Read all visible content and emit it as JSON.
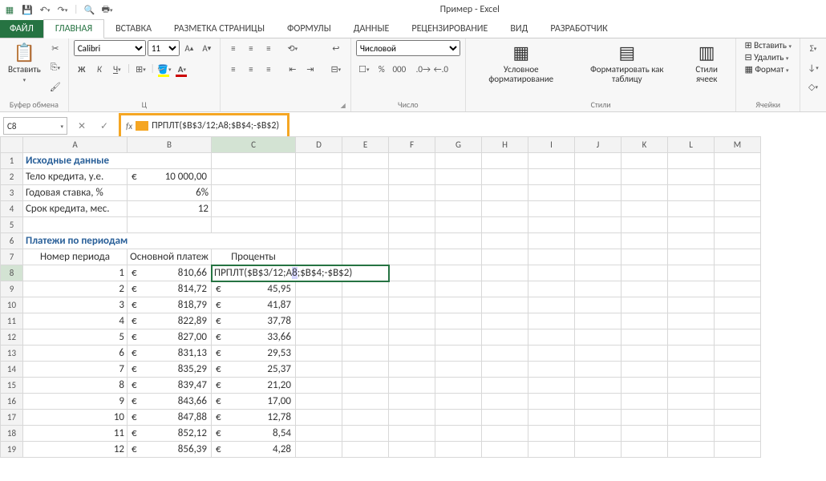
{
  "title": "Пример - Excel",
  "tabs": {
    "file": "ФАЙЛ",
    "list": [
      "ГЛАВНАЯ",
      "ВСТАВКА",
      "РАЗМЕТКА СТРАНИЦЫ",
      "ФОРМУЛЫ",
      "ДАННЫЕ",
      "РЕЦЕНЗИРОВАНИЕ",
      "ВИД",
      "РАЗРАБОТЧИК"
    ]
  },
  "ribbon": {
    "paste": "Вставить",
    "clipboard_label": "Буфер обмена",
    "font_name": "Calibri",
    "font_size": "11",
    "font_label": "Ц",
    "number_format": "Числовой",
    "number_label": "Число",
    "cond_fmt": "Условное форматирование",
    "fmt_table": "Форматировать как таблицу",
    "cell_styles": "Стили ячеек",
    "styles_label": "Стили",
    "insert": "Вставить",
    "delete": "Удалить",
    "format": "Формат",
    "cells_label": "Ячейки"
  },
  "formula_bar": {
    "name_box": "C8",
    "formula": "ПРПЛТ($B$3/12;A8;$B$4;-$B$2)"
  },
  "columns": [
    "A",
    "B",
    "C",
    "D",
    "E",
    "F",
    "G",
    "H",
    "I",
    "J",
    "K",
    "L",
    "M"
  ],
  "sheet": {
    "r1": {
      "A": "Исходные данные"
    },
    "r2": {
      "A": "Тело кредита, у.е.",
      "B_sym": "€",
      "B_val": "10 000,00"
    },
    "r3": {
      "A": "Годовая ставка, %",
      "B": "6%"
    },
    "r4": {
      "A": "Срок кредита, мес.",
      "B": "12"
    },
    "r6": {
      "A": "Платежи по периодам"
    },
    "r7": {
      "A": "Номер периода",
      "B": "Основной платеж",
      "C": "Проценты"
    },
    "rows": [
      {
        "n": "1",
        "b": "810,66",
        "c_formula": "ПРПЛТ($B$3/12;A8;$B$4;-$B$2)",
        "c_arg_hl": "8"
      },
      {
        "n": "2",
        "b": "814,72",
        "c": "45,95"
      },
      {
        "n": "3",
        "b": "818,79",
        "c": "41,87"
      },
      {
        "n": "4",
        "b": "822,89",
        "c": "37,78"
      },
      {
        "n": "5",
        "b": "827,00",
        "c": "33,66"
      },
      {
        "n": "6",
        "b": "831,13",
        "c": "29,53"
      },
      {
        "n": "7",
        "b": "835,29",
        "c": "25,37"
      },
      {
        "n": "8",
        "b": "839,47",
        "c": "21,20"
      },
      {
        "n": "9",
        "b": "843,66",
        "c": "17,00"
      },
      {
        "n": "10",
        "b": "847,88",
        "c": "12,78"
      },
      {
        "n": "11",
        "b": "852,12",
        "c": "8,54"
      },
      {
        "n": "12",
        "b": "856,39",
        "c": "4,28"
      }
    ]
  }
}
